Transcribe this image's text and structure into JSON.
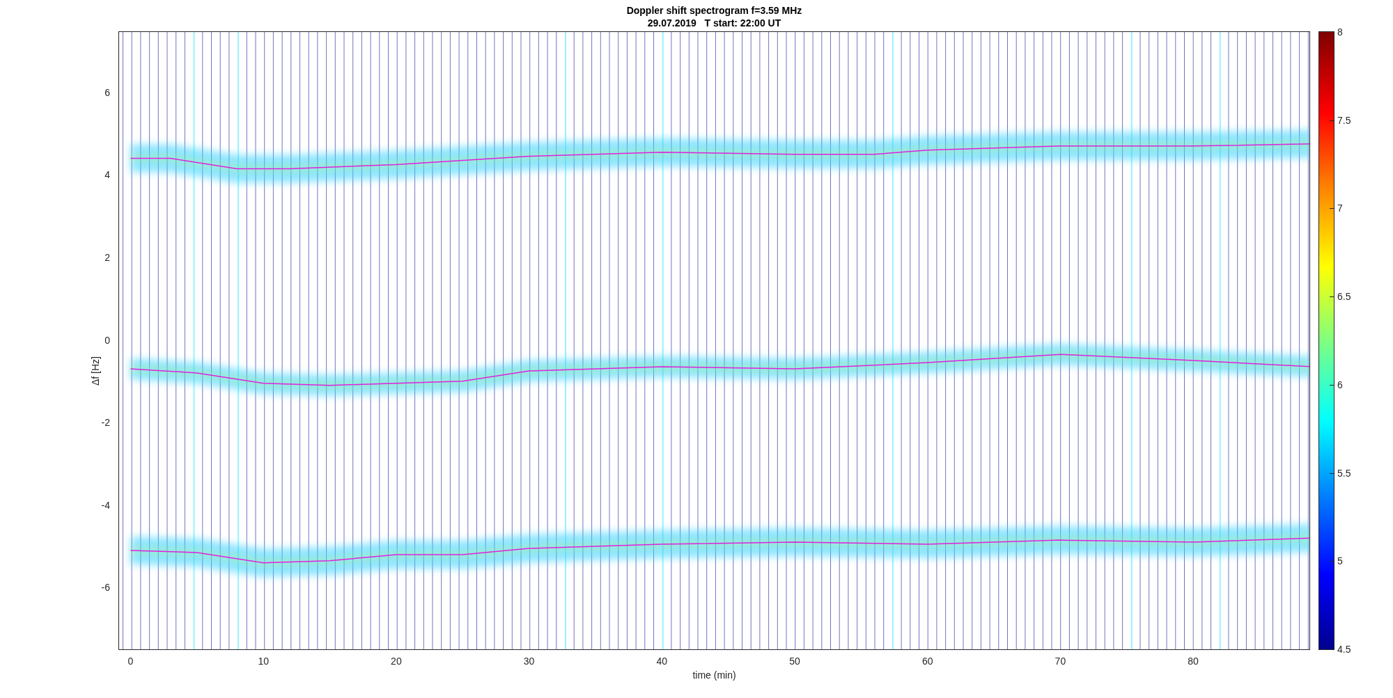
{
  "figure": {
    "title_lines": [
      "Doppler shift spectrogram f=3.59 MHz",
      "29.07.2019   T start: 22:00 UT"
    ],
    "xlabel": "time (min)",
    "ylabel": "Δf [Hz]",
    "xticks": [
      "0",
      "10",
      "20",
      "30",
      "40",
      "50",
      "60",
      "70",
      "80"
    ],
    "yticks": [
      "6",
      "4",
      "2",
      "0",
      "-2",
      "-4",
      "-6"
    ],
    "colorbar": {
      "ticks": [
        "8",
        "7.5",
        "7",
        "6.5",
        "6",
        "5.5",
        "5",
        "4.5"
      ]
    }
  }
}
